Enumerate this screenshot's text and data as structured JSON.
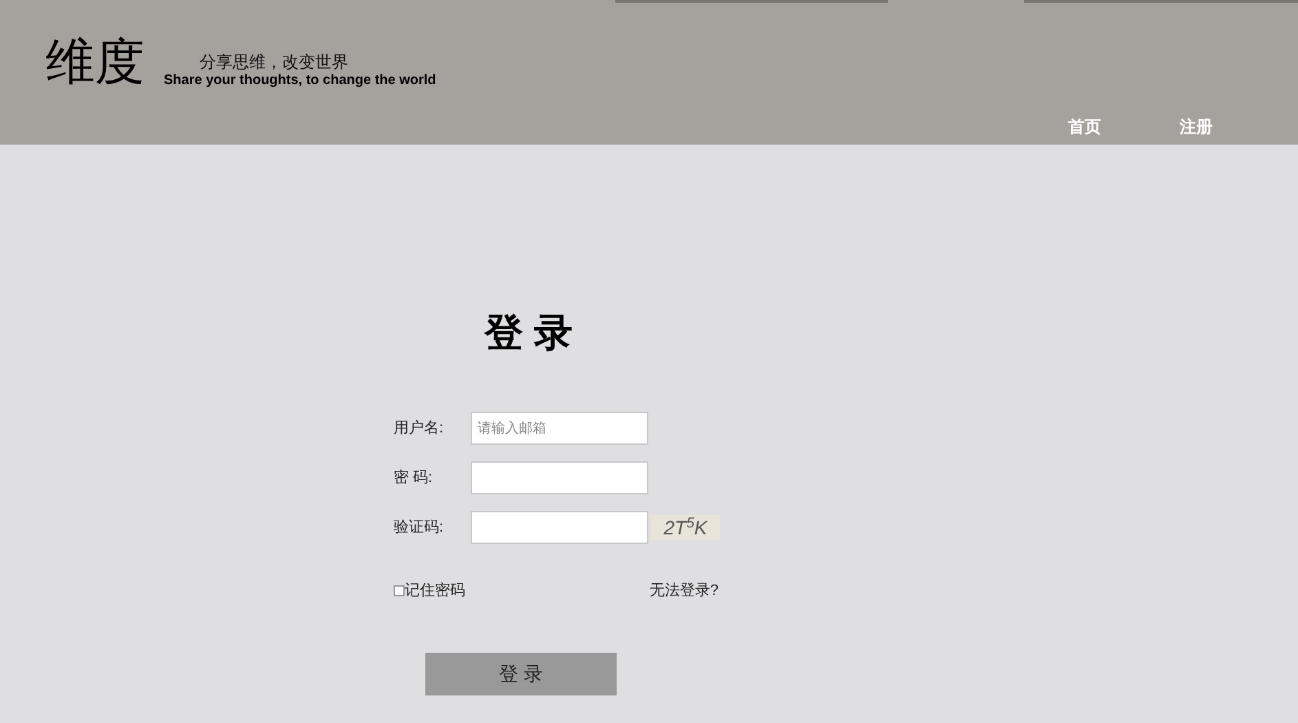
{
  "header": {
    "logo": "维度",
    "slogan": "分享思维，改变世界",
    "slogan_en": "Share your thoughts, to change the world",
    "nav": [
      {
        "label": "首页"
      },
      {
        "label": "注册"
      }
    ]
  },
  "login": {
    "title": "登 录",
    "fields": [
      {
        "label": "用户名:",
        "placeholder": "请输入邮箱",
        "kind": "text"
      },
      {
        "label": "密 码:",
        "kind": "password"
      },
      {
        "label": "验证码:",
        "kind": "captcha",
        "captcha": "2T$^{5}$K"
      }
    ],
    "remember": {
      "label": "记住密码",
      "checked": false
    },
    "forgot": "无法登录?",
    "submit": "登 录"
  }
}
